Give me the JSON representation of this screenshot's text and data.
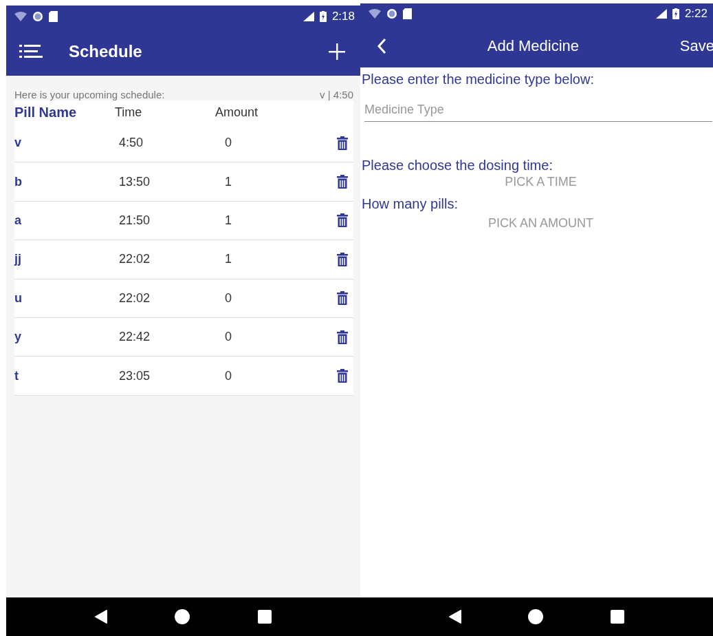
{
  "schedule_screen": {
    "status_bar": {
      "time": "2:18"
    },
    "app_bar": {
      "title": "Schedule"
    },
    "intro": "Here is your upcoming schedule:",
    "next_dose": "v | 4:50",
    "table": {
      "columns": [
        "Pill Name",
        "Time",
        "Amount"
      ],
      "rows": [
        {
          "name": "v",
          "time": "4:50",
          "amount": "0"
        },
        {
          "name": "b",
          "time": "13:50",
          "amount": "1"
        },
        {
          "name": "a",
          "time": "21:50",
          "amount": "1"
        },
        {
          "name": "jj",
          "time": "22:02",
          "amount": "1"
        },
        {
          "name": "u",
          "time": "22:02",
          "amount": "0"
        },
        {
          "name": "y",
          "time": "22:42",
          "amount": "0"
        },
        {
          "name": "t",
          "time": "23:05",
          "amount": "0"
        }
      ]
    }
  },
  "add_medicine_screen": {
    "status_bar": {
      "time": "2:22"
    },
    "app_bar": {
      "title": "Add Medicine",
      "action": "Save"
    },
    "type_prompt": "Please enter the medicine type below:",
    "type_field": {
      "placeholder": "Medicine Type"
    },
    "time_prompt": "Please choose the dosing time:",
    "time_button": "PICK A TIME",
    "amount_prompt": "How many pills:",
    "amount_button": "PICK AN AMOUNT"
  }
}
